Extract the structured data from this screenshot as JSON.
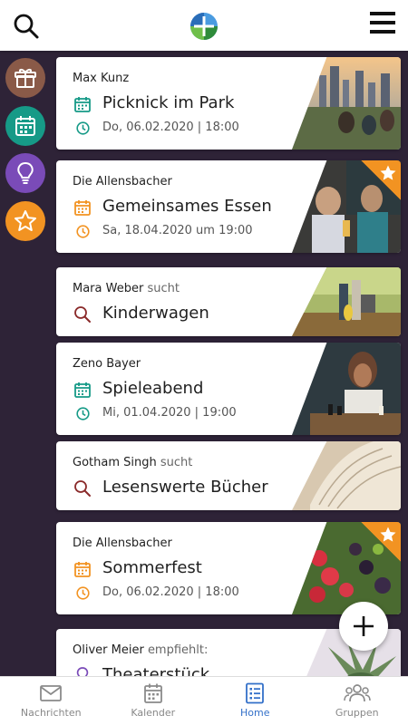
{
  "colors": {
    "accent_orange": "#f29322",
    "accent_teal": "#169a87",
    "accent_purple": "#7a4bb8",
    "accent_brown": "#8a5a48",
    "active_blue": "#3370c9",
    "background": "#2e2337"
  },
  "header": {
    "search_icon": "search-icon",
    "logo_icon": "app-logo",
    "menu_icon": "hamburger-menu-icon"
  },
  "rail": [
    {
      "icon": "gift-icon",
      "color": "#8a5a48"
    },
    {
      "icon": "calendar-icon",
      "color": "#169a87"
    },
    {
      "icon": "lightbulb-icon",
      "color": "#7a4bb8"
    },
    {
      "icon": "star-icon",
      "color": "#f29322"
    }
  ],
  "feed": [
    {
      "author": "Max Kunz",
      "author_suffix": "",
      "title": "Picknick im Park",
      "meta": "Do, 06.02.2020 | 18:00",
      "title_icon": "calendar-icon",
      "meta_icon": "clock-icon",
      "accent": "#169a87",
      "featured": false
    },
    {
      "author": "Die Allensbacher",
      "author_suffix": "",
      "title": "Gemeinsames Essen",
      "meta": "Sa, 18.04.2020 um 19:00",
      "title_icon": "calendar-icon",
      "meta_icon": "clock-icon",
      "accent": "#f29322",
      "featured": true
    },
    {
      "author": "Mara Weber",
      "author_suffix": "sucht",
      "title": "Kinderwagen",
      "meta": "",
      "title_icon": "search-icon",
      "accent": "#8a2a2a",
      "featured": false
    },
    {
      "author": "Zeno Bayer",
      "author_suffix": "",
      "title": "Spieleabend",
      "meta": "Mi, 01.04.2020 | 19:00",
      "title_icon": "calendar-icon",
      "meta_icon": "clock-icon",
      "accent": "#169a87",
      "featured": false
    },
    {
      "author": "Gotham Singh",
      "author_suffix": "sucht",
      "title": "Lesenswerte Bücher",
      "meta": "",
      "title_icon": "search-icon",
      "accent": "#8a2a2a",
      "featured": false
    },
    {
      "author": "Die Allensbacher",
      "author_suffix": "",
      "title": "Sommerfest",
      "meta": "Do, 06.02.2020 | 18:00",
      "title_icon": "calendar-icon",
      "meta_icon": "clock-icon",
      "accent": "#f29322",
      "featured": true
    },
    {
      "author": "Oliver Meier",
      "author_suffix": "empfiehlt:",
      "title": "Theaterstück",
      "meta": "",
      "title_icon": "lightbulb-icon",
      "accent": "#7a4bb8",
      "featured": false
    }
  ],
  "fab": {
    "icon": "plus-icon"
  },
  "nav": [
    {
      "label": "Nachrichten",
      "icon": "mail-icon",
      "active": false
    },
    {
      "label": "Kalender",
      "icon": "calendar-icon",
      "active": false
    },
    {
      "label": "Home",
      "icon": "home-list-icon",
      "active": true
    },
    {
      "label": "Gruppen",
      "icon": "people-icon",
      "active": false
    }
  ]
}
